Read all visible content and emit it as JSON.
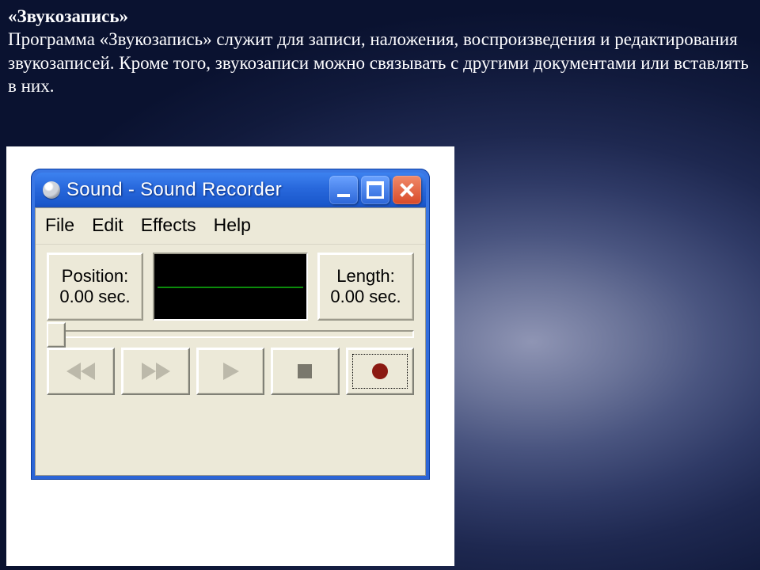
{
  "slide": {
    "heading": "«Звукозапись»",
    "body": "Программа «Звукозапись» служит для записи, наложения, воспроизведения и редактирования звукозаписей. Кроме того, звукозаписи можно связывать с другими документами или вставлять в них."
  },
  "window": {
    "title": "Sound - Sound Recorder",
    "menus": {
      "file": "File",
      "edit": "Edit",
      "effects": "Effects",
      "help": "Help"
    },
    "position": {
      "label": "Position:",
      "value": "0.00 sec."
    },
    "length": {
      "label": "Length:",
      "value": "0.00 sec."
    },
    "buttons": {
      "rewind": "seek-to-start",
      "forward": "seek-to-end",
      "play": "play",
      "stop": "stop",
      "record": "record"
    }
  }
}
